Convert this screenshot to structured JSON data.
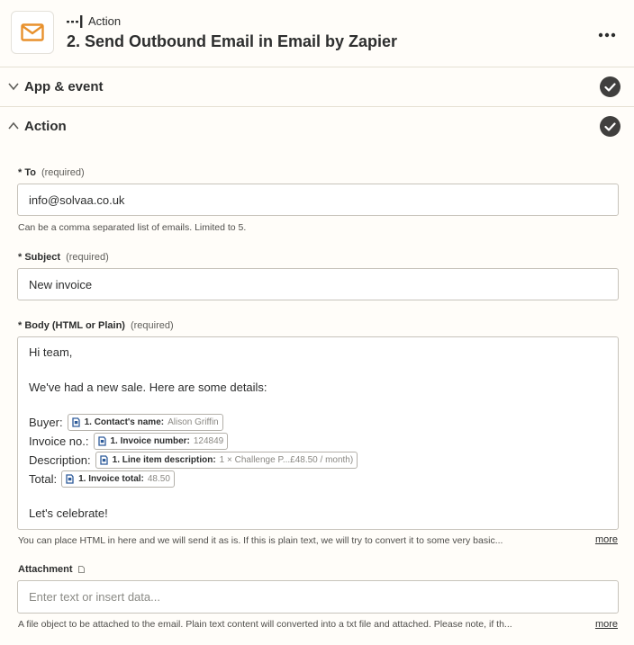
{
  "header": {
    "icon": "envelope-icon",
    "step_type": "Action",
    "step_title": "2. Send Outbound Email in Email by Zapier",
    "menu_label": "•••"
  },
  "sections": {
    "app_event": {
      "label": "App & event",
      "state": "complete"
    },
    "action": {
      "label": "Action",
      "state": "complete"
    }
  },
  "fields": {
    "to": {
      "label": "* To",
      "required": "(required)",
      "value": "info@solvaa.co.uk",
      "help": "Can be a comma separated list of emails. Limited to 5."
    },
    "subject": {
      "label": "* Subject",
      "required": "(required)",
      "value": "New invoice"
    },
    "body": {
      "label": "* Body (HTML or Plain)",
      "required": "(required)",
      "lines": {
        "greeting": "Hi team,",
        "intro": "We've had a new sale. Here are some details:",
        "buyer": "Buyer:",
        "invoice_no": "Invoice no.:",
        "description": "Description:",
        "total": "Total:",
        "closing": "Let's celebrate!"
      },
      "pills": {
        "buyer": {
          "key": "1. Contact's name:",
          "value": "Alison Griffin"
        },
        "invoice_no": {
          "key": "1. Invoice number:",
          "value": "124849"
        },
        "description": {
          "key": "1. Line item description:",
          "value": "1 × Challenge P...£48.50 / month)"
        },
        "total": {
          "key": "1. Invoice total:",
          "value": "48.50"
        }
      },
      "help": "You can place HTML in here and we will send it as is. If this is plain text, we will try to convert it to some very basic...",
      "more": "more"
    },
    "attachment": {
      "label": "Attachment",
      "placeholder": "Enter text or insert data...",
      "help": "A file object to be attached to the email. Plain text content will converted into a txt file and attached. Please note, if th...",
      "more": "more"
    }
  },
  "colors": {
    "background": "#fffdf9",
    "icon_orange": "#e8912d",
    "check_dark": "#403f3e",
    "border": "#c7c3bb"
  }
}
